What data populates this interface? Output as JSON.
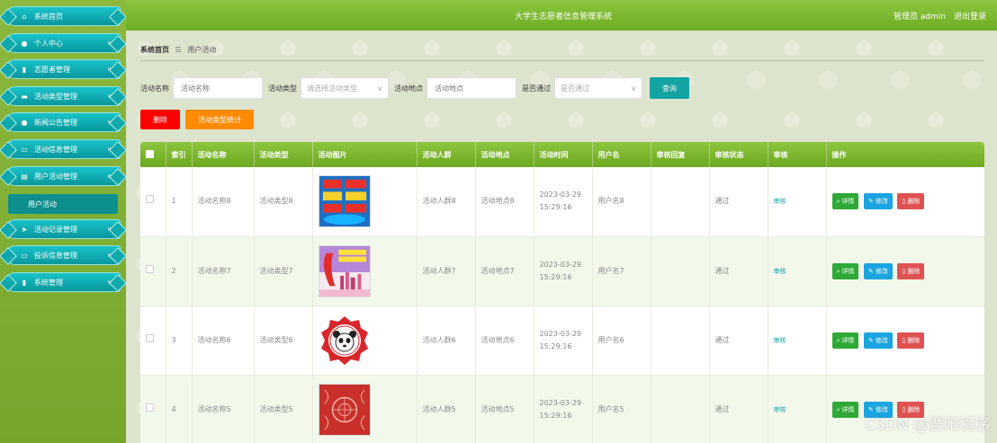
{
  "header": {
    "app_title": "大学生志愿者信息管理系统",
    "user_label": "管理员 admin",
    "logout_label": "退出登录"
  },
  "sidebar": {
    "items": [
      {
        "label": "系统首页",
        "icon": "home-icon"
      },
      {
        "label": "个人中心",
        "icon": "person-icon"
      },
      {
        "label": "志愿者管理",
        "icon": "chart-icon"
      },
      {
        "label": "活动类型管理",
        "icon": "monitor-icon"
      },
      {
        "label": "新闻公告管理",
        "icon": "person-icon"
      },
      {
        "label": "活动信息管理",
        "icon": "chat-icon"
      },
      {
        "label": "用户活动管理",
        "icon": "printer-icon"
      },
      {
        "label": "活动记录管理",
        "icon": "send-icon"
      },
      {
        "label": "投诉信息管理",
        "icon": "chat-icon"
      },
      {
        "label": "系统管理",
        "icon": "chart-icon"
      }
    ],
    "submenu_active": "用户活动"
  },
  "breadcrumb": {
    "home": "系统首页",
    "separator": "☰",
    "current": "用户活动"
  },
  "search": {
    "name_label": "活动名称",
    "name_placeholder": "活动名称",
    "type_label": "活动类型",
    "type_placeholder": "请选择活动类型",
    "place_label": "活动地点",
    "place_placeholder": "活动地点",
    "pass_label": "是否通过",
    "pass_placeholder": "是否通过",
    "query_button": "查询"
  },
  "actions": {
    "delete": "删除",
    "stats": "活动类型统计"
  },
  "table": {
    "headers": [
      "",
      "索引",
      "活动名称",
      "活动类型",
      "活动图片",
      "活动人群",
      "活动地点",
      "活动时间",
      "用户名",
      "审核回复",
      "审核状态",
      "审核",
      "操作"
    ],
    "rows": [
      {
        "index": "1",
        "name": "活动名称8",
        "type": "活动类型8",
        "crowd": "活动人群8",
        "place": "活动地点8",
        "time": "2023-03-29 15:29:16",
        "user": "用户名8",
        "reply": "",
        "status": "通过",
        "audit": "审核",
        "image": "poster-blue"
      },
      {
        "index": "2",
        "name": "活动名称7",
        "type": "活动类型7",
        "crowd": "活动人群7",
        "place": "活动地点7",
        "time": "2023-03-29 15:29:16",
        "user": "用户名7",
        "reply": "",
        "status": "通过",
        "audit": "审核",
        "image": "poster-volunteer"
      },
      {
        "index": "3",
        "name": "活动名称6",
        "type": "活动类型6",
        "crowd": "活动人群6",
        "place": "活动地点6",
        "time": "2023-03-29 15:29:16",
        "user": "用户名6",
        "reply": "",
        "status": "通过",
        "audit": "审核",
        "image": "logo-panda"
      },
      {
        "index": "4",
        "name": "活动名称5",
        "type": "活动类型5",
        "crowd": "活动人群5",
        "place": "活动地点5",
        "time": "2023-03-29 15:29:16",
        "user": "用户名5",
        "reply": "",
        "status": "通过",
        "audit": "审核",
        "image": "pattern-red"
      }
    ],
    "op_detail": "详情",
    "op_edit": "修改",
    "op_delete": "删除"
  },
  "watermark": "CSDN @暨阳程序",
  "colors": {
    "primary": "#13a3a3",
    "header_green": "#7bb92e",
    "danger": "#ff0000",
    "warning": "#ff8a00"
  }
}
